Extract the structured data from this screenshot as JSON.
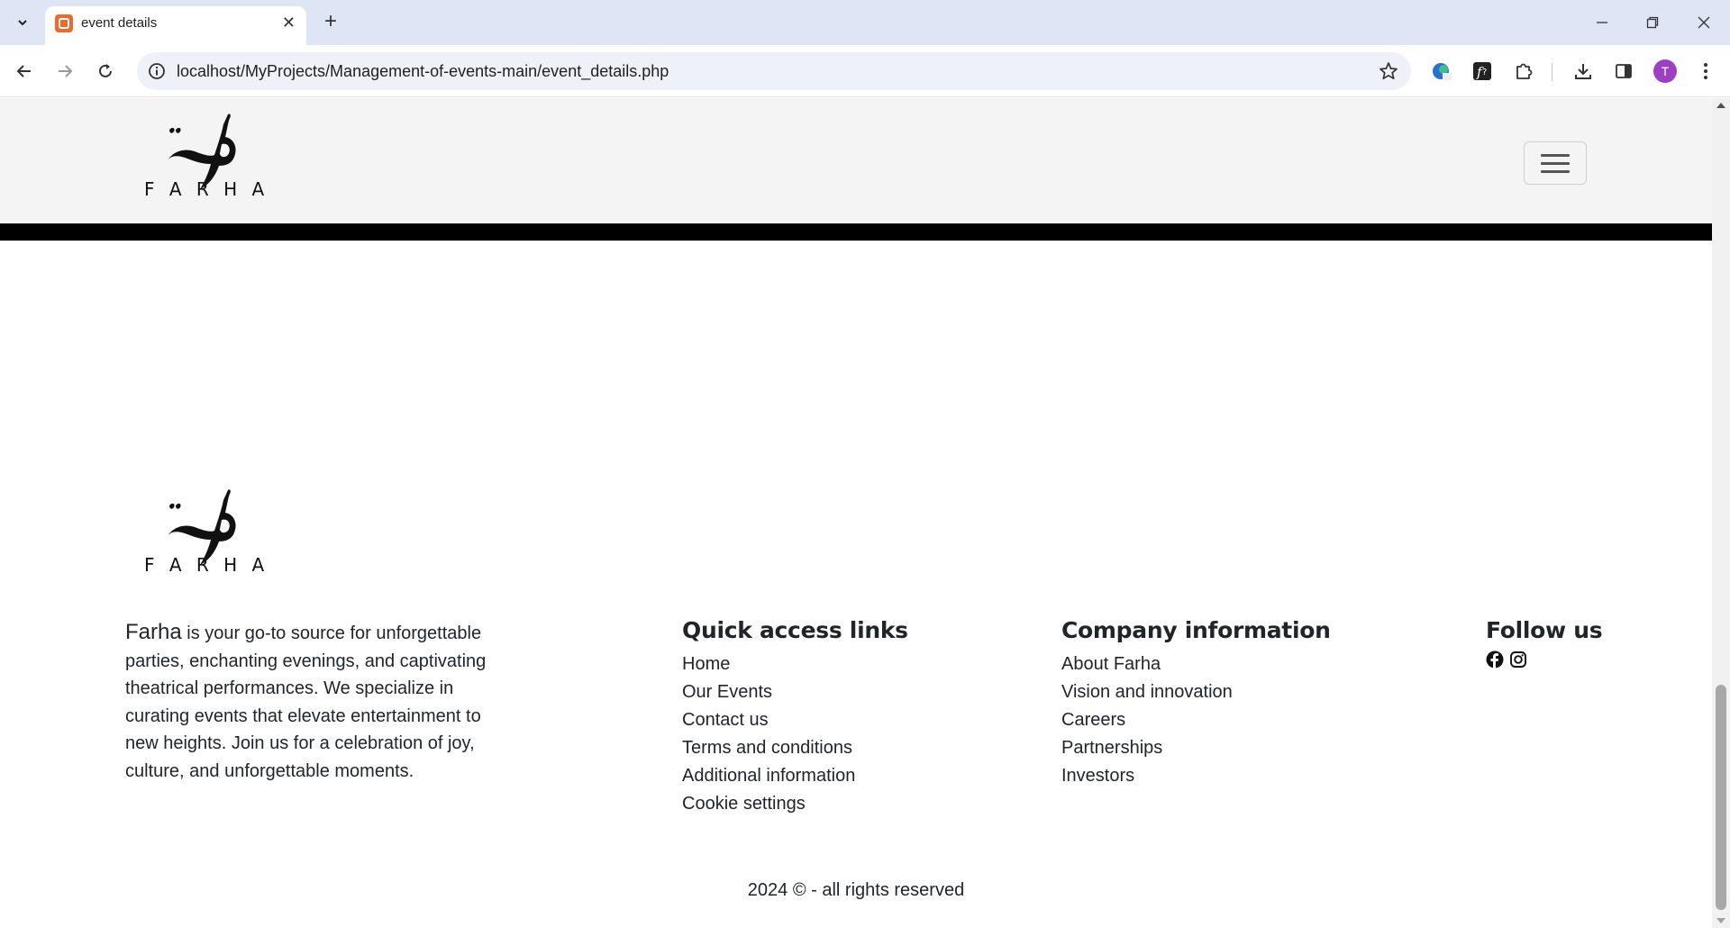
{
  "browser": {
    "tab_title": "event details",
    "url": "localhost/MyProjects/Management-of-events-main/event_details.php",
    "profile_initial": "T",
    "colors": {
      "tabstrip": "#dee6f6",
      "favicon": "#ea6b2c",
      "avatar": "#9c3fc2"
    }
  },
  "header": {
    "logo_latin": "F A R H A",
    "menu_icon": "hamburger-icon"
  },
  "footer": {
    "logo_latin": "F A R H A",
    "about_brand": "Farha",
    "about_text": " is your go-to source for unforgettable parties, enchanting evenings, and captivating theatrical performances. We specialize in curating events that elevate entertainment to new heights. Join us for a celebration of joy, culture, and unforgettable moments.",
    "quick_links": {
      "title": "Quick access links",
      "items": [
        "Home",
        "Our Events",
        "Contact us",
        "Terms and conditions",
        "Additional information",
        "Cookie settings"
      ]
    },
    "company": {
      "title": "Company information",
      "items": [
        "About Farha",
        "Vision and innovation",
        "Careers",
        "Partnerships",
        "Investors"
      ]
    },
    "follow": {
      "title": "Follow us",
      "icons": [
        "facebook-icon",
        "instagram-icon"
      ]
    },
    "copyright": "2024 © - all rights reserved"
  }
}
